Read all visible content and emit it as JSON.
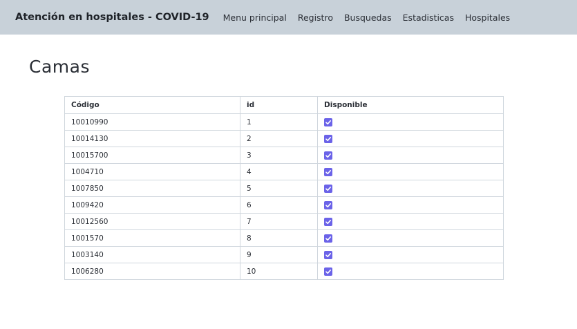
{
  "app": {
    "brand": "Atención en hospitales - COVID-19"
  },
  "nav": {
    "items": [
      "Menu principal",
      "Registro",
      "Busquedas",
      "Estadisticas",
      "Hospitales"
    ]
  },
  "page": {
    "title": "Camas"
  },
  "table": {
    "headers": [
      "Código",
      "id",
      "Disponible"
    ],
    "rows": [
      {
        "codigo": "10010990",
        "id": "1",
        "disponible": true
      },
      {
        "codigo": "10014130",
        "id": "2",
        "disponible": true
      },
      {
        "codigo": "10015700",
        "id": "3",
        "disponible": true
      },
      {
        "codigo": "1004710",
        "id": "4",
        "disponible": true
      },
      {
        "codigo": "1007850",
        "id": "5",
        "disponible": true
      },
      {
        "codigo": "1009420",
        "id": "6",
        "disponible": true
      },
      {
        "codigo": "10012560",
        "id": "7",
        "disponible": true
      },
      {
        "codigo": "1001570",
        "id": "8",
        "disponible": true
      },
      {
        "codigo": "1003140",
        "id": "9",
        "disponible": true
      },
      {
        "codigo": "1006280",
        "id": "10",
        "disponible": true
      }
    ]
  },
  "colors": {
    "navbar_bg": "#c8d1d9",
    "checkbox_accent": "#6b63e8",
    "table_border": "#cfd6dd"
  }
}
